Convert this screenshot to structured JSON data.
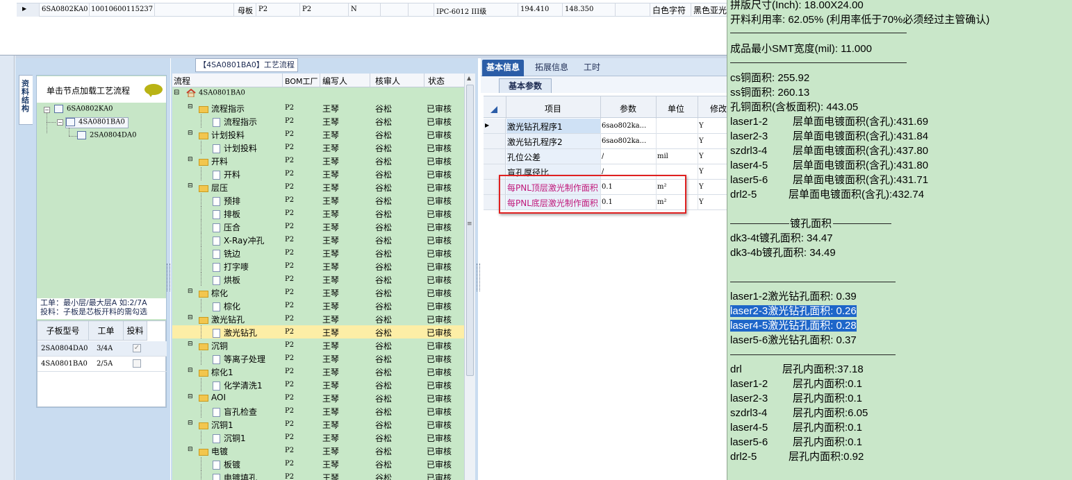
{
  "top_grid": {
    "row": [
      "6SA0802KA0",
      "10010600115237",
      "",
      "母板",
      "P2",
      "P2",
      "N",
      "",
      "IPC-6012 III级",
      "194.410",
      "148.350",
      "白色字符",
      "黑色亚光"
    ]
  },
  "left_panel": {
    "vertical_tab": "资料结构",
    "load_hint": "单击节点加载工艺流程",
    "tree": [
      "6SA0802KA0",
      "4SA0801BA0",
      "2SA0804DA0"
    ],
    "note_line1": "工单：最小层/最大层A 如:2/7A",
    "note_line2": "投料：子板是芯板开料的需勾选",
    "sub_table": {
      "headers": [
        "子板型号",
        "工单",
        "投料"
      ],
      "rows": [
        {
          "model": "2SA0804DA0",
          "order": "3/4A",
          "checked": true
        },
        {
          "model": "4SA0801BA0",
          "order": "2/5A",
          "checked": false
        }
      ]
    }
  },
  "flow_panel": {
    "title": "【4SA0801BA0】工艺流程",
    "headers": [
      "流程",
      "BOM工厂",
      "编写人",
      "核审人",
      "状态"
    ],
    "root": "4SA0801BA0",
    "rows": [
      {
        "name": "流程指示",
        "kind": "folder",
        "factory": "P2",
        "writer": "王琴",
        "reviewer": "谷松",
        "status": "已审核"
      },
      {
        "name": "流程指示",
        "kind": "doc",
        "factory": "P2",
        "writer": "王琴",
        "reviewer": "谷松",
        "status": "已审核"
      },
      {
        "name": "计划投料",
        "kind": "folder",
        "factory": "P2",
        "writer": "王琴",
        "reviewer": "谷松",
        "status": "已审核"
      },
      {
        "name": "计划投料",
        "kind": "doc",
        "factory": "P2",
        "writer": "王琴",
        "reviewer": "谷松",
        "status": "已审核"
      },
      {
        "name": "开料",
        "kind": "folder",
        "factory": "P2",
        "writer": "王琴",
        "reviewer": "谷松",
        "status": "已审核"
      },
      {
        "name": "开料",
        "kind": "doc",
        "factory": "P2",
        "writer": "王琴",
        "reviewer": "谷松",
        "status": "已审核"
      },
      {
        "name": "层压",
        "kind": "folder",
        "factory": "P2",
        "writer": "王琴",
        "reviewer": "谷松",
        "status": "已审核"
      },
      {
        "name": "预排",
        "kind": "doc",
        "factory": "P2",
        "writer": "王琴",
        "reviewer": "谷松",
        "status": "已审核"
      },
      {
        "name": "排板",
        "kind": "doc",
        "factory": "P2",
        "writer": "王琴",
        "reviewer": "谷松",
        "status": "已审核"
      },
      {
        "name": "压合",
        "kind": "doc",
        "factory": "P2",
        "writer": "王琴",
        "reviewer": "谷松",
        "status": "已审核"
      },
      {
        "name": "X-Ray冲孔",
        "kind": "doc",
        "factory": "P2",
        "writer": "王琴",
        "reviewer": "谷松",
        "status": "已审核"
      },
      {
        "name": "铣边",
        "kind": "doc",
        "factory": "P2",
        "writer": "王琴",
        "reviewer": "谷松",
        "status": "已审核"
      },
      {
        "name": "打字嘜",
        "kind": "doc",
        "factory": "P2",
        "writer": "王琴",
        "reviewer": "谷松",
        "status": "已审核"
      },
      {
        "name": "烘板",
        "kind": "doc",
        "factory": "P2",
        "writer": "王琴",
        "reviewer": "谷松",
        "status": "已审核"
      },
      {
        "name": "棕化",
        "kind": "folder",
        "factory": "P2",
        "writer": "王琴",
        "reviewer": "谷松",
        "status": "已审核"
      },
      {
        "name": "棕化",
        "kind": "doc",
        "factory": "P2",
        "writer": "王琴",
        "reviewer": "谷松",
        "status": "已审核"
      },
      {
        "name": "激光钻孔",
        "kind": "folder",
        "factory": "P2",
        "writer": "王琴",
        "reviewer": "谷松",
        "status": "已审核"
      },
      {
        "name": "激光钻孔",
        "kind": "doc",
        "factory": "P2",
        "writer": "王琴",
        "reviewer": "谷松",
        "status": "已审核",
        "selected": true
      },
      {
        "name": "沉铜",
        "kind": "folder",
        "factory": "P2",
        "writer": "王琴",
        "reviewer": "谷松",
        "status": "已审核"
      },
      {
        "name": "等离子处理",
        "kind": "doc",
        "factory": "P2",
        "writer": "王琴",
        "reviewer": "谷松",
        "status": "已审核"
      },
      {
        "name": "棕化1",
        "kind": "folder",
        "factory": "P2",
        "writer": "王琴",
        "reviewer": "谷松",
        "status": "已审核"
      },
      {
        "name": "化学清洗1",
        "kind": "doc",
        "factory": "P2",
        "writer": "王琴",
        "reviewer": "谷松",
        "status": "已审核"
      },
      {
        "name": "AOI",
        "kind": "folder",
        "factory": "P2",
        "writer": "王琴",
        "reviewer": "谷松",
        "status": "已审核"
      },
      {
        "name": "盲孔检查",
        "kind": "doc",
        "factory": "P2",
        "writer": "王琴",
        "reviewer": "谷松",
        "status": "已审核"
      },
      {
        "name": "沉铜1",
        "kind": "folder",
        "factory": "P2",
        "writer": "王琴",
        "reviewer": "谷松",
        "status": "已审核"
      },
      {
        "name": "沉铜1",
        "kind": "doc",
        "factory": "P2",
        "writer": "王琴",
        "reviewer": "谷松",
        "status": "已审核"
      },
      {
        "name": "电镀",
        "kind": "folder",
        "factory": "P2",
        "writer": "王琴",
        "reviewer": "谷松",
        "status": "已审核"
      },
      {
        "name": "板镀",
        "kind": "doc",
        "factory": "P2",
        "writer": "王琴",
        "reviewer": "谷松",
        "status": "已审核"
      },
      {
        "name": "电镀填孔",
        "kind": "doc",
        "factory": "P2",
        "writer": "王琴",
        "reviewer": "谷松",
        "status": "已审核"
      }
    ]
  },
  "detail_panel": {
    "tabs": [
      "基本信息",
      "拓展信息",
      "工时"
    ],
    "subtab": "基本参数",
    "headers": [
      "项目",
      "参数",
      "单位",
      "修改"
    ],
    "rows": [
      {
        "item": "激光钻孔程序1",
        "value": "6sao802ka...",
        "unit": "",
        "modify": "Y",
        "current": true
      },
      {
        "item": "激光钻孔程序2",
        "value": "6sao802ka...",
        "unit": "",
        "modify": "Y"
      },
      {
        "item": "孔位公差",
        "value": "/",
        "unit": "mil",
        "modify": "Y"
      },
      {
        "item": "盲孔厚径比",
        "value": "/",
        "unit": "",
        "modify": "Y"
      },
      {
        "item": "每PNL顶层激光制作面积",
        "value": "0.1",
        "unit": "m²",
        "modify": "Y",
        "highlight": true
      },
      {
        "item": "每PNL底层激光制作面积",
        "value": "0.1",
        "unit": "m²",
        "modify": "Y",
        "highlight": true
      }
    ]
  },
  "info_panel": {
    "lines": [
      {
        "text": "拼版尺寸(Inch): 18.00X24.00"
      },
      {
        "text": "开料利用率: 62.05% (利用率低于70%必须经过主管确认)"
      },
      {
        "text": "成品最小SMT宽度(mil): 11.000"
      },
      {
        "text": "cs铜面积: 255.92"
      },
      {
        "text": "ss铜面积: 260.13"
      },
      {
        "text": "孔铜面积(含板面积): 443.05"
      },
      {
        "a": "laser1-2",
        "b": "层单面电镀面积(含孔):431.69"
      },
      {
        "a": "laser2-3",
        "b": "层单面电镀面积(含孔):431.84"
      },
      {
        "a": "szdrl3-4",
        "b": "层单面电镀面积(含孔):437.80"
      },
      {
        "a": "laser4-5",
        "b": "层单面电镀面积(含孔):431.80"
      },
      {
        "a": "laser5-6",
        "b": "层单面电镀面积(含孔):431.71"
      },
      {
        "a": "drl2-5",
        "b": "层单面电镀面积(含孔):432.74"
      },
      {
        "text": "镀孔面积"
      },
      {
        "text": "dk3-4t镀孔面积: 34.47"
      },
      {
        "text": "dk3-4b镀孔面积: 34.49"
      },
      {
        "text": "laser1-2激光钻孔面积: 0.39"
      },
      {
        "text": "laser2-3激光钻孔面积: 0.26",
        "selected": true
      },
      {
        "text": "laser4-5激光钻孔面积: 0.28",
        "selected": true
      },
      {
        "text": "laser5-6激光钻孔面积: 0.37"
      },
      {
        "a": "drl",
        "b": "层孔内面积:37.18"
      },
      {
        "a": "laser1-2",
        "b": "层孔内面积:0.1"
      },
      {
        "a": "laser2-3",
        "b": "层孔内面积:0.1"
      },
      {
        "a": "szdrl3-4",
        "b": "层孔内面积:6.05"
      },
      {
        "a": "laser4-5",
        "b": "层孔内面积:0.1"
      },
      {
        "a": "laser5-6",
        "b": "层孔内面积:0.1"
      },
      {
        "a": "drl2-5",
        "b": "层孔内面积:0.92"
      }
    ]
  }
}
